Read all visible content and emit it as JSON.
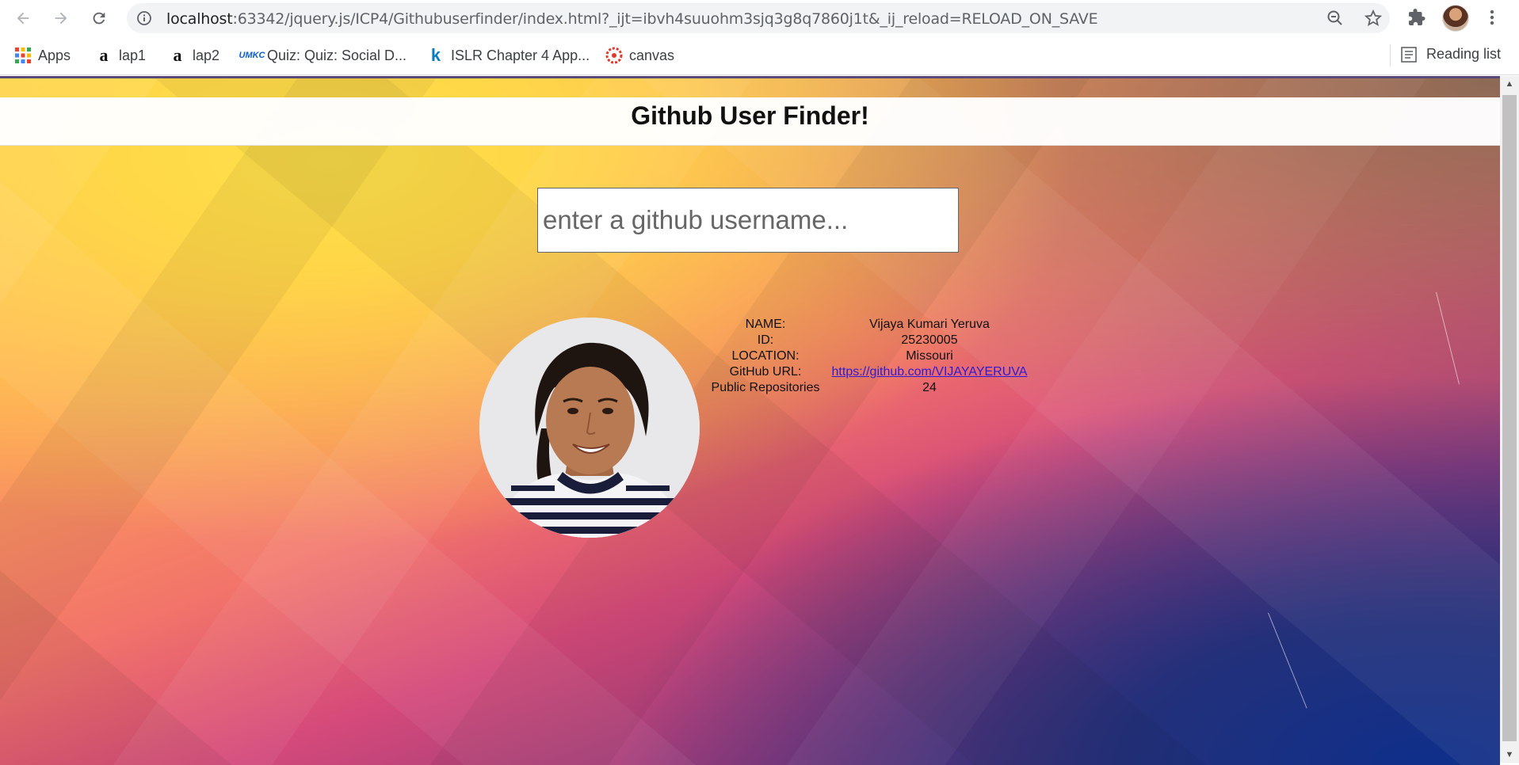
{
  "browser": {
    "url_host": "localhost",
    "url_rest": ":63342/jquery.js/ICP4/Githubuserfinder/index.html?_ijt=ibvh4suuohm3sjq3g8q7860j1t&_ij_reload=RELOAD_ON_SAVE",
    "bookmarks": [
      {
        "label": "Apps",
        "icon": "apps-grid-icon"
      },
      {
        "label": "lap1",
        "icon": "amazon-icon"
      },
      {
        "label": "lap2",
        "icon": "amazon-icon"
      },
      {
        "label": "Quiz: Quiz: Social D...",
        "icon": "umkc-icon"
      },
      {
        "label": "ISLR Chapter 4 App...",
        "icon": "k-icon"
      },
      {
        "label": "canvas",
        "icon": "canvas-icon"
      }
    ],
    "reading_list": "Reading list"
  },
  "page": {
    "title": "Github User Finder!",
    "search_placeholder": "enter a github username...",
    "profile": {
      "rows": [
        {
          "label": "NAME:",
          "value": "Vijaya Kumari Yeruva"
        },
        {
          "label": "ID:",
          "value": "25230005"
        },
        {
          "label": "LOCATION:",
          "value": "Missouri"
        },
        {
          "label": "GitHub URL:",
          "value": "https://github.com/VIJAYAYERUVA"
        },
        {
          "label": "Public Repositories",
          "value": "24"
        }
      ]
    }
  }
}
